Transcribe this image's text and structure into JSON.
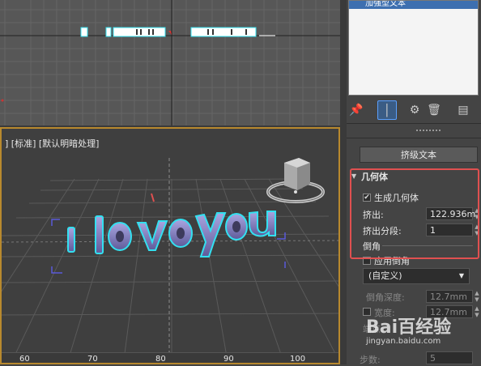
{
  "viewport": {
    "label": "] [标准] [默认明暗处理]",
    "text_preview": "I love you",
    "ruler_ticks": [
      "60",
      "70",
      "80",
      "90",
      "100"
    ]
  },
  "panel": {
    "list_selected": "加强型文本",
    "extrude_text_button": "挤级文本",
    "rollout_title": "几何体",
    "generate_geometry": "生成几何体",
    "extrude_label": "挤出:",
    "extrude_value": "122.936m",
    "extrude_segments_label": "挤出分段:",
    "extrude_segments_value": "1",
    "bevel_group": "倒角",
    "apply_bevel": "应用倒角",
    "bevel_preset": "(自定义)",
    "bevel_depth_label": "倒角深度:",
    "bevel_depth_value": "12.7mm",
    "width_label": "宽度:",
    "width_value": "12.7mm",
    "end_label": "端点:",
    "steps_label": "步数:",
    "steps_value": "5"
  },
  "watermark": {
    "brand": "Bai百经验",
    "url": "jingyan.baidu.com"
  },
  "colors": {
    "accent_selection": "#3d6fb0",
    "highlight_box": "#e05050",
    "viewport_border": "#b8892e",
    "text_outline": "#33e0f0",
    "text_fill": "#7c78b8"
  }
}
